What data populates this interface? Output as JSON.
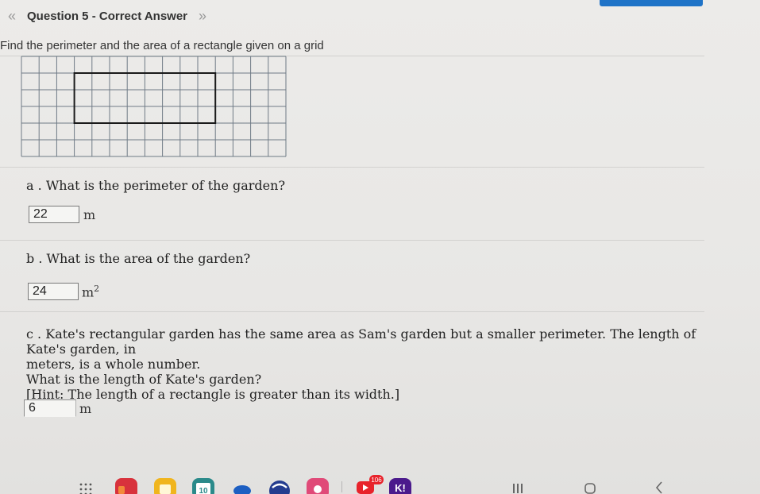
{
  "header": {
    "prev_icon": "double-chevron-left-icon",
    "title": "Question 5 - Correct Answer",
    "next_icon": "double-chevron-right-icon"
  },
  "instruction": "Find the perimeter and the area of a rectangle given on a grid",
  "grid": {
    "columns": 15,
    "rows": 6,
    "rectangle": {
      "col_start": 3,
      "row_start": 1,
      "width_cells": 8,
      "height_cells": 3
    }
  },
  "parts": [
    {
      "label": "a .",
      "question": "What is the perimeter of the garden?",
      "answer": "22",
      "unit": "m"
    },
    {
      "label": "b .",
      "question": "What is the area of the garden?",
      "answer": "24",
      "unit": "m",
      "unit_sup": "2"
    },
    {
      "label": "c .",
      "question_lines": [
        "Kate's rectangular garden has the same area as Sam's garden but a smaller perimeter. The length of Kate's garden, in",
        "meters, is a whole number.",
        "What is the length of Kate's garden?",
        "[Hint: The length of a rectangle is greater than its width.]"
      ],
      "answer": "6",
      "unit": "m"
    }
  ],
  "taskbar": {
    "calendar_date": "10",
    "notification_badge": "106",
    "kahoot_label": "K!",
    "icons": [
      "app-drawer-icon",
      "app-red-icon",
      "app-yellow-icon",
      "calendar-icon",
      "app-blue-icon",
      "app-navy-icon",
      "youtube-icon",
      "kahoot-icon",
      "recents-icon",
      "home-icon",
      "back-icon"
    ],
    "colors": {
      "red": "#d8323c",
      "yellow": "#f0b51e",
      "teal": "#2a8a8a",
      "blue": "#1d5fc2",
      "navy": "#243c8f",
      "youtube": "#e8232b",
      "kahoot": "#4b1a8c"
    }
  }
}
